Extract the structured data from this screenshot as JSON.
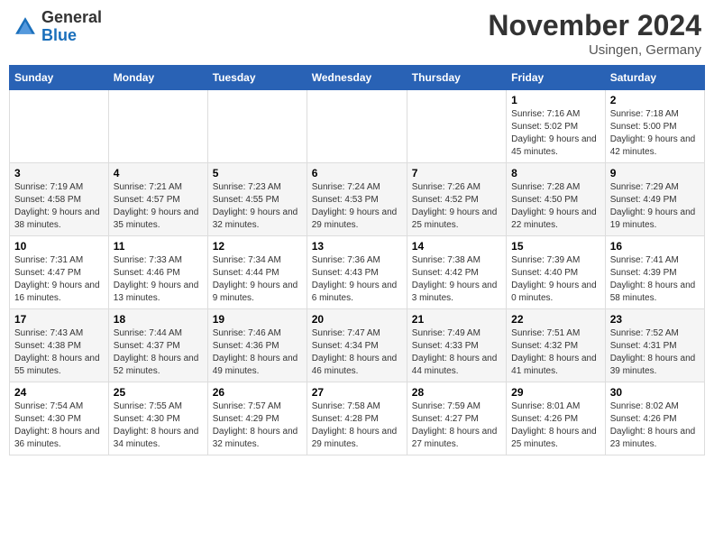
{
  "header": {
    "logo_text_general": "General",
    "logo_text_blue": "Blue",
    "month_title": "November 2024",
    "location": "Usingen, Germany"
  },
  "days_of_week": [
    "Sunday",
    "Monday",
    "Tuesday",
    "Wednesday",
    "Thursday",
    "Friday",
    "Saturday"
  ],
  "weeks": [
    [
      {
        "day": "",
        "info": ""
      },
      {
        "day": "",
        "info": ""
      },
      {
        "day": "",
        "info": ""
      },
      {
        "day": "",
        "info": ""
      },
      {
        "day": "",
        "info": ""
      },
      {
        "day": "1",
        "info": "Sunrise: 7:16 AM\nSunset: 5:02 PM\nDaylight: 9 hours and 45 minutes."
      },
      {
        "day": "2",
        "info": "Sunrise: 7:18 AM\nSunset: 5:00 PM\nDaylight: 9 hours and 42 minutes."
      }
    ],
    [
      {
        "day": "3",
        "info": "Sunrise: 7:19 AM\nSunset: 4:58 PM\nDaylight: 9 hours and 38 minutes."
      },
      {
        "day": "4",
        "info": "Sunrise: 7:21 AM\nSunset: 4:57 PM\nDaylight: 9 hours and 35 minutes."
      },
      {
        "day": "5",
        "info": "Sunrise: 7:23 AM\nSunset: 4:55 PM\nDaylight: 9 hours and 32 minutes."
      },
      {
        "day": "6",
        "info": "Sunrise: 7:24 AM\nSunset: 4:53 PM\nDaylight: 9 hours and 29 minutes."
      },
      {
        "day": "7",
        "info": "Sunrise: 7:26 AM\nSunset: 4:52 PM\nDaylight: 9 hours and 25 minutes."
      },
      {
        "day": "8",
        "info": "Sunrise: 7:28 AM\nSunset: 4:50 PM\nDaylight: 9 hours and 22 minutes."
      },
      {
        "day": "9",
        "info": "Sunrise: 7:29 AM\nSunset: 4:49 PM\nDaylight: 9 hours and 19 minutes."
      }
    ],
    [
      {
        "day": "10",
        "info": "Sunrise: 7:31 AM\nSunset: 4:47 PM\nDaylight: 9 hours and 16 minutes."
      },
      {
        "day": "11",
        "info": "Sunrise: 7:33 AM\nSunset: 4:46 PM\nDaylight: 9 hours and 13 minutes."
      },
      {
        "day": "12",
        "info": "Sunrise: 7:34 AM\nSunset: 4:44 PM\nDaylight: 9 hours and 9 minutes."
      },
      {
        "day": "13",
        "info": "Sunrise: 7:36 AM\nSunset: 4:43 PM\nDaylight: 9 hours and 6 minutes."
      },
      {
        "day": "14",
        "info": "Sunrise: 7:38 AM\nSunset: 4:42 PM\nDaylight: 9 hours and 3 minutes."
      },
      {
        "day": "15",
        "info": "Sunrise: 7:39 AM\nSunset: 4:40 PM\nDaylight: 9 hours and 0 minutes."
      },
      {
        "day": "16",
        "info": "Sunrise: 7:41 AM\nSunset: 4:39 PM\nDaylight: 8 hours and 58 minutes."
      }
    ],
    [
      {
        "day": "17",
        "info": "Sunrise: 7:43 AM\nSunset: 4:38 PM\nDaylight: 8 hours and 55 minutes."
      },
      {
        "day": "18",
        "info": "Sunrise: 7:44 AM\nSunset: 4:37 PM\nDaylight: 8 hours and 52 minutes."
      },
      {
        "day": "19",
        "info": "Sunrise: 7:46 AM\nSunset: 4:36 PM\nDaylight: 8 hours and 49 minutes."
      },
      {
        "day": "20",
        "info": "Sunrise: 7:47 AM\nSunset: 4:34 PM\nDaylight: 8 hours and 46 minutes."
      },
      {
        "day": "21",
        "info": "Sunrise: 7:49 AM\nSunset: 4:33 PM\nDaylight: 8 hours and 44 minutes."
      },
      {
        "day": "22",
        "info": "Sunrise: 7:51 AM\nSunset: 4:32 PM\nDaylight: 8 hours and 41 minutes."
      },
      {
        "day": "23",
        "info": "Sunrise: 7:52 AM\nSunset: 4:31 PM\nDaylight: 8 hours and 39 minutes."
      }
    ],
    [
      {
        "day": "24",
        "info": "Sunrise: 7:54 AM\nSunset: 4:30 PM\nDaylight: 8 hours and 36 minutes."
      },
      {
        "day": "25",
        "info": "Sunrise: 7:55 AM\nSunset: 4:30 PM\nDaylight: 8 hours and 34 minutes."
      },
      {
        "day": "26",
        "info": "Sunrise: 7:57 AM\nSunset: 4:29 PM\nDaylight: 8 hours and 32 minutes."
      },
      {
        "day": "27",
        "info": "Sunrise: 7:58 AM\nSunset: 4:28 PM\nDaylight: 8 hours and 29 minutes."
      },
      {
        "day": "28",
        "info": "Sunrise: 7:59 AM\nSunset: 4:27 PM\nDaylight: 8 hours and 27 minutes."
      },
      {
        "day": "29",
        "info": "Sunrise: 8:01 AM\nSunset: 4:26 PM\nDaylight: 8 hours and 25 minutes."
      },
      {
        "day": "30",
        "info": "Sunrise: 8:02 AM\nSunset: 4:26 PM\nDaylight: 8 hours and 23 minutes."
      }
    ]
  ]
}
